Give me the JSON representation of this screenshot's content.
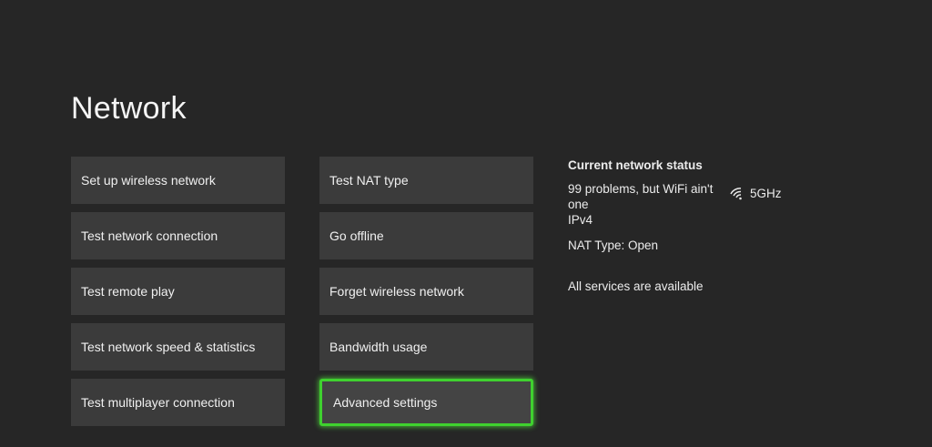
{
  "page": {
    "title": "Network"
  },
  "menu": {
    "left_column": [
      {
        "label": "Set up wireless network"
      },
      {
        "label": "Test network connection"
      },
      {
        "label": "Test remote play"
      },
      {
        "label": "Test network speed & statistics"
      },
      {
        "label": "Test multiplayer connection"
      }
    ],
    "right_column": [
      {
        "label": "Test NAT type"
      },
      {
        "label": "Go offline"
      },
      {
        "label": "Forget wireless network"
      },
      {
        "label": "Bandwidth usage"
      },
      {
        "label": "Advanced settings",
        "focused": true
      }
    ]
  },
  "status": {
    "heading": "Current network status",
    "network_name": "99 problems, but WiFi ain't one",
    "band": "5GHz",
    "band_icon": "wifi-icon",
    "ip_version": "IPv4",
    "nat_type": "NAT Type: Open",
    "services": "All services are available"
  },
  "colors": {
    "background": "#262626",
    "tile": "#3b3b3b",
    "focus_accent": "#3fd12f",
    "text": "#f2f2f2"
  }
}
